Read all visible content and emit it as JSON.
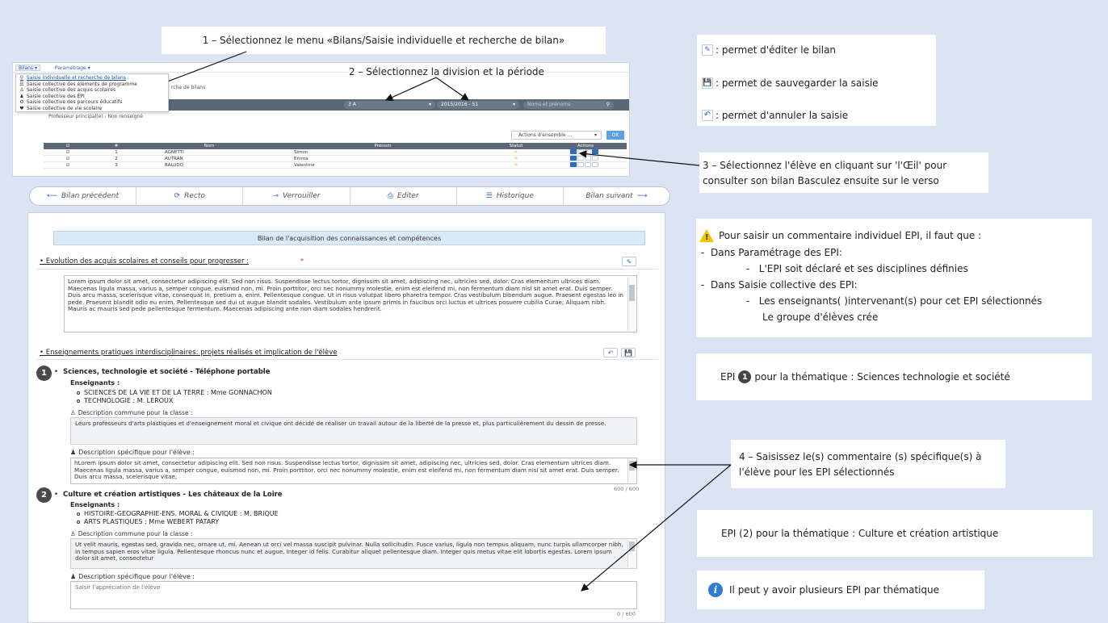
{
  "callouts": {
    "step1": "1 – Sélectionnez le menu «Bilans/Saisie individuelle  et recherche de bilan»",
    "step2": "2 – Sélectionnez la division et la période",
    "step3": "3 – Sélectionnez l'élève en cliquant sur 'l'Œil' pour consulter son  bilan Basculez ensuite sur le verso",
    "step4": "4 – Saisissez le(s) commentaire (s) spécifique(s) à l'élève pour les EPI sélectionnés",
    "icons_legend": [
      {
        "icon": "pencil-icon",
        "text": ": permet d'éditer le bilan"
      },
      {
        "icon": "save-icon",
        "text": ": permet de sauvegarder la saisie"
      },
      {
        "icon": "undo-icon",
        "text": ": permet d'annuler la saisie"
      }
    ],
    "warning": {
      "intro": "Pour saisir un commentaire individuel  EPI, il faut que :",
      "line1": "Dans Paramétrage des EPI:",
      "line1a": "L'EPI soit déclaré et ses disciplines définies",
      "line2": "Dans Saisie collective des EPI:",
      "line2a": "Les enseignants(  )intervenant(s)  pour cet EPI sélectionnés",
      "line2b": "Le groupe d'élèves  crée"
    },
    "epi1": {
      "prefix": "EPI",
      "num": "1",
      "text": "pour la thématique :  Sciences technologie et société"
    },
    "epi2": "EPI (2) pour la thématique :  Culture et création artistique",
    "info": "Il peut y avoir plusieurs EPI par thématique"
  },
  "menu": {
    "bilans": "Bilans ▾",
    "parametrage": "Paramétrage ▾",
    "items": [
      {
        "icon": "search-icon",
        "label": "Saisie individuelle et recherche de bilans"
      },
      {
        "icon": "list-icon",
        "label": "Saisie collective des éléments de programme"
      },
      {
        "icon": "group-icon",
        "label": "Saisie collective des acquis scolaires"
      },
      {
        "icon": "users-icon",
        "label": "Saisie collective des EPI"
      },
      {
        "icon": "gear-icon",
        "label": "Saisie collective des parcours éducatifs"
      },
      {
        "icon": "heart-icon",
        "label": "Saisie collective de vie scolaire"
      }
    ],
    "crumb": "rche de bilans",
    "hidden_text": "Professeur principal(e) : Non renseigné",
    "division": "3 A",
    "periode": "2015/2016 - S1",
    "search_placeholder": "Noms et prénoms",
    "actions_label": "Actions d'ensemble ...",
    "ok": "OK",
    "columns": [
      "☑",
      "#",
      "Nom",
      "Prénom",
      "Statut",
      "Actions"
    ],
    "rows": [
      {
        "n": "1",
        "nom": "AGNETTI",
        "prenom": "Simon"
      },
      {
        "n": "2",
        "nom": "AUTRAN",
        "prenom": "Emma"
      },
      {
        "n": "3",
        "nom": "BALUDO",
        "prenom": "Valentine"
      }
    ]
  },
  "nav": {
    "prev": "Bilan précédent",
    "recto": "Recto",
    "lock": "Verrouiller",
    "edit": "Editer",
    "history": "Historique",
    "next": "Bilan suivant"
  },
  "bilan": {
    "title": "Bilan de l'acquisition des connaissances et compétences",
    "evolution_title": "• Evolution des acquis scolaires et conseils pour progresser :",
    "evolution_text": "Lorem ipsum dolor sit amet, consectetur adipiscing elit. Sed non risus. Suspendisse lectus tortor, dignissim sit amet, adipiscing nec, ultricies sed, dolor. Cras elementum ultrices diam. Maecenas ligula massa, varius a, semper congue, euismod non, mi. Proin porttitor, orci nec nonummy molestie, enim est eleifend mi, non fermentum diam nisl sit amet erat. Duis semper. Duis arcu massa, scelerisque vitae, consequat in, pretium a, enim. Pellentesque congue. Ut in risus volutpat libero pharetra tempor. Cras vestibulum bibendum augue. Praesent egestas leo in pede. Praesent blandit odio eu enim. Pellentesque sed dui ut augue blandit sodales. Vestibulum ante ipsum primis in faucibus orci luctus et ultrices posuere cubilia Curae; Aliquam nibh. Mauris ac mauris sed pede pellentesque fermentum. Maecenas adipiscing ante non diam sodales hendrerit.",
    "epi_title": "• Enseignements pratiques interdisciplinaires: projets réalisés et implication de l'élève",
    "epi1": {
      "title": "Sciences, technologie et société - Téléphone portable",
      "teachers_label": "Enseignants :",
      "teachers": [
        "SCIENCES DE LA VIE ET DE LA TERRE : Mme GONNACHON",
        "TECHNOLOGIE : M. LEROUX"
      ],
      "common_label": "Description commune pour la classe :",
      "common_text": "Leurs professeurs d'arts plastiques et d'enseignement moral et civique ont décidé de réaliser un travail autour de la liberté de la presse et, plus particulièrement du dessin de presse.",
      "specific_label": "Description spécifique pour l'élève :",
      "specific_text": "hLorem ipsum dolor sit amet, consectetur adipiscing elit. Sed non risus. Suspendisse lectus tortor, dignissim sit amet, adipiscing nec, ultricies sed, dolor. Cras elementum ultrices diam. Maecenas ligula massa, varius a, semper congue, euismod non, mi. Proin porttitor, orci nec nonummy molestie, enim est eleifend mi, non fermentum diam nisl sit amet erat. Duis semper. Duis arcu massa, scelerisque vitae,",
      "counter": "600 / 600"
    },
    "epi2": {
      "title": "Culture et création artistiques - Les châteaux de la Loire",
      "teachers_label": "Enseignants :",
      "teachers": [
        "HISTOIRE-GEOGRAPHIE-ENS. MORAL & CIVIQUE : M. BRIQUE",
        "ARTS PLASTIQUES : Mme WEBERT PATARY"
      ],
      "common_label": "Description commune pour la classe :",
      "common_text": "Ut velit mauris, egestas sed, gravida nec, ornare ut, mi. Aenean ut orci vel massa suscipit pulvinar. Nulla sollicitudin. Fusce varius, ligula non tempus aliquam, nunc turpis ullamcorper nibh, in tempus sapien eros vitae ligula. Pellentesque rhoncus nunc et augue. Integer id felis. Curabitur aliquet pellentesque diam. Integer quis metus vitae elit lobortis egestas. Lorem ipsum dolor sit amet, consectetur",
      "specific_label": "Description spécifique pour l'élève :",
      "specific_placeholder": "Saisir l'appréciation de l'élève",
      "counter": "0 / 600"
    }
  }
}
